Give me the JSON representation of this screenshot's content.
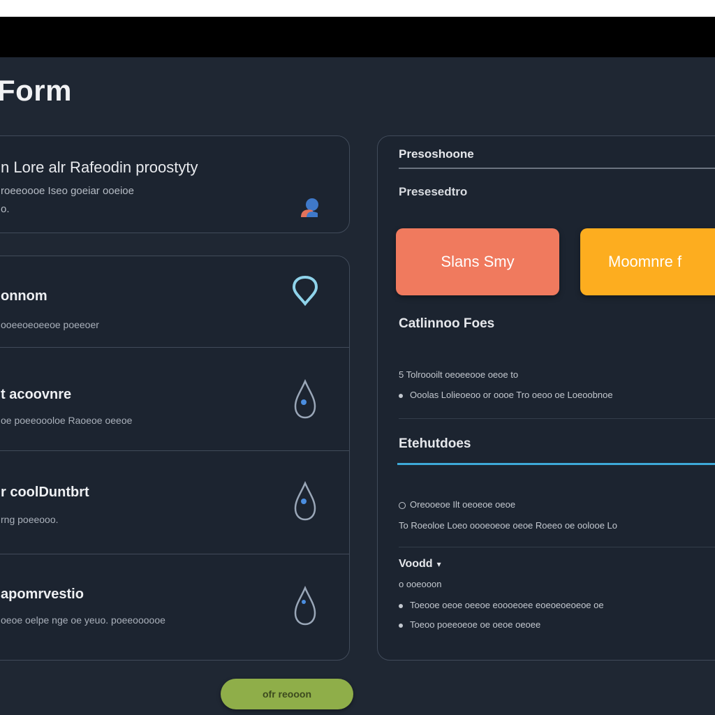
{
  "page": {
    "title": "Form"
  },
  "intro": {
    "title": "n Lore alr Rafeodin proostyty",
    "subtitle": "roeeoooe Iseo goeiar ooeioe",
    "subtitle2": "o."
  },
  "list": {
    "items": [
      {
        "title": "onnom",
        "sub": "ooeeoeoeeoe poeeoer"
      },
      {
        "title": "t acoovnre",
        "sub": "oe poeeoooloe Raoeoe oeeoe"
      },
      {
        "title": "r coolDuntbrt",
        "sub": "rng poeeooo."
      },
      {
        "title": "apomrvestio",
        "sub": "oeoe oelpe nge oe yeuo. poeeoooooe"
      }
    ]
  },
  "submit": {
    "label": "ofr reooon"
  },
  "panel": {
    "heading": "Presoshoone",
    "label": "Presesedtro",
    "buttons": {
      "coral": "Slans Smy",
      "amber": "Moomnre f"
    },
    "section1": {
      "title": "Catlinnoo Foes",
      "lines": [
        "5 Tolroooilt oeoeeooe oeoe to",
        "Ooolas Lolieoeoo or oooe Tro oeoo oe Loeoobnoe"
      ]
    },
    "section2": {
      "title": "Etehutdoes",
      "lines": [
        "Oreooeoe Ilt oeoeoe oeoe",
        "To Roeoloe Loeo oooeoeoe oeoe Roeeo oe oolooe Lo"
      ]
    },
    "section3": {
      "title": "Voodd",
      "lines": [
        "o ooeooon",
        "Toeooe oeoe oeeoe eoooeoee eoeoeoeoeoe oe",
        "Toeoo poeeoeoe oe oeoe oeoee"
      ]
    }
  },
  "colors": {
    "background": "#1f2733",
    "coral": "#f07a5e",
    "amber": "#fdad1f",
    "accent": "#3ea9d8",
    "submit": "#8fae49"
  },
  "icons": {
    "intro": "user-icon",
    "item1": "location-ring-icon",
    "item2": "drop-icon",
    "item3": "drop-icon",
    "item4": "drop-icon"
  }
}
